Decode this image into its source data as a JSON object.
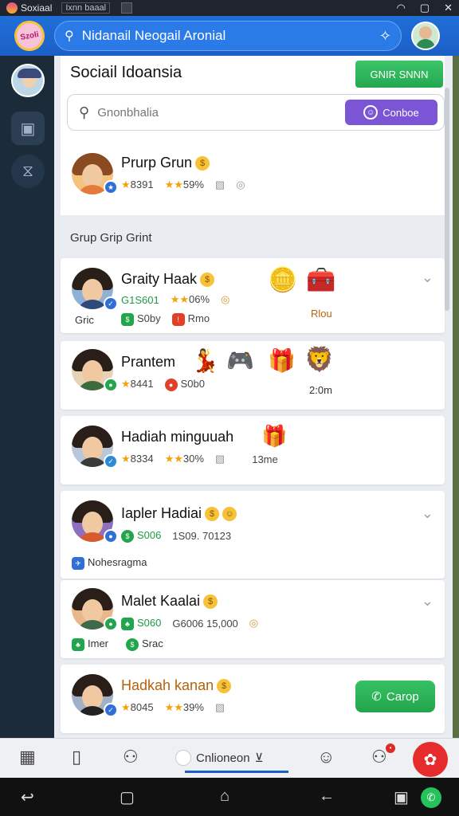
{
  "statusbar": {
    "app_title": "Soxiaal",
    "tab_title": "Ixnn baaal",
    "icons": [
      "wifi-icon",
      "minimize-icon",
      "close-icon"
    ]
  },
  "appbar": {
    "logo_text": "Szoli",
    "search_text": "Nidanail Neogail Aronial"
  },
  "panel": {
    "title": "Sociail Idoansia",
    "top_button": "GNIR SNNN",
    "search_placeholder": "Gnonbhalia",
    "search_button": "Conboe"
  },
  "section_title": "Grup Grip Grint",
  "cards": [
    {
      "name": "Prurp Grun",
      "stat1": "8391",
      "stat2": "59%"
    },
    {
      "name": "Graity Haak",
      "stat1": "G1S601",
      "stat2": "06%",
      "line2a": "S0by",
      "line2b": "Rmo",
      "side_label": "Gric",
      "sticker_label": "Rlou"
    },
    {
      "name": "Prantem",
      "stat1": "8441",
      "stat2": "S0b0",
      "sticker_label": "2:0m"
    },
    {
      "name": "Hadiah minguuah",
      "stat1": "8334",
      "stat2": "30%",
      "sticker_label": "13me"
    },
    {
      "name": "Iapler Hadiai",
      "stat1": "S006",
      "stat2": "1S09. 70123",
      "foot": "Nohesragma"
    },
    {
      "name": "Malet Kaalai",
      "stat1": "S060",
      "stat2": "G6006 15,000",
      "foot_a": "Imer",
      "foot_b": "Srac"
    },
    {
      "name": "Hadkah kanan",
      "stat1": "8045",
      "stat2": "39%",
      "button": "Carop"
    }
  ],
  "bottomnav": {
    "tab_label": "Cnlioneon"
  },
  "colors": {
    "appbar": "#1f6fd8",
    "green_button": "#2ab35a",
    "purple_button": "#7b55d6",
    "star": "#f2a20a",
    "fab": "#e52b2b"
  }
}
